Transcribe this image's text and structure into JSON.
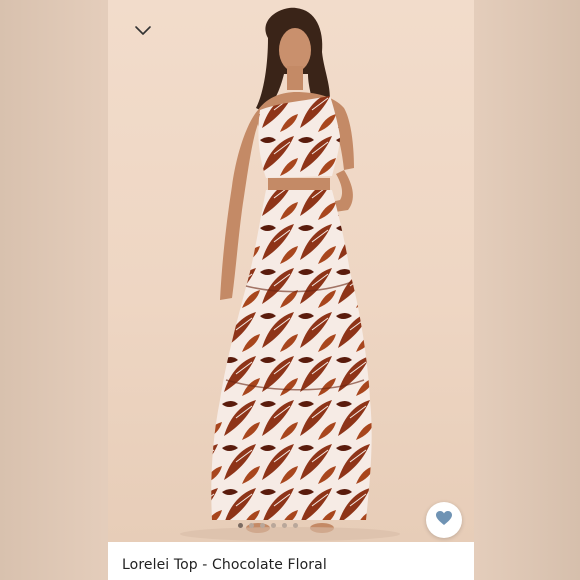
{
  "product": {
    "title": "Lorelei Top - Chocolate Floral"
  },
  "carousel": {
    "dots": 6,
    "active_index": 0
  },
  "icons": {
    "collapse": "chevron-down-icon",
    "favorite": "heart-icon"
  },
  "colors": {
    "backdrop": "#e4cdbb",
    "print_primary": "#8e3418",
    "print_dark": "#5a1b0c",
    "print_light": "#f7ece6",
    "favorite_heart": "#6f93b4"
  }
}
